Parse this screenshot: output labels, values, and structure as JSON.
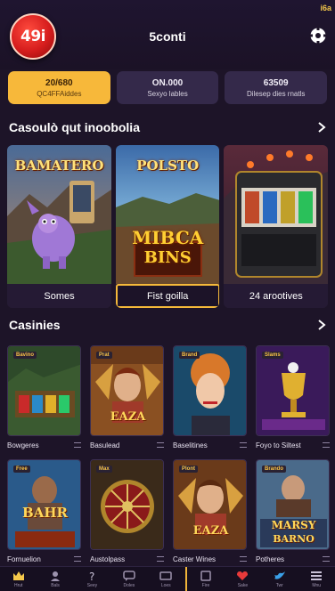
{
  "header": {
    "logo_text": "49i",
    "title": "5conti",
    "corner_text": "i6a"
  },
  "stats": [
    {
      "value": "20/680",
      "label": "QC4FFAiddes",
      "active": true
    },
    {
      "value": "ON.000",
      "label": "Sexyo lables",
      "active": false
    },
    {
      "value": "63509",
      "label": "Dilesep dies rnatls",
      "active": false
    }
  ],
  "featured": {
    "title": "Casoulò qut inoobolia",
    "cards": [
      {
        "art_title": "BAMATERO",
        "caption": "Somes"
      },
      {
        "art_title_top": "POLSTO",
        "art_title_bottom_1": "MIBCA",
        "art_title_bottom_2": "BINS",
        "caption": "Fist goilla"
      },
      {
        "art_title": "",
        "caption": "24 arootives"
      }
    ]
  },
  "casinos": {
    "title": "Casinies",
    "row1": [
      {
        "tag": "Bavino",
        "art": "",
        "name": "Bowgeres"
      },
      {
        "tag": "Prat",
        "art": "EAZA",
        "name": "Basulead"
      },
      {
        "tag": "Brand",
        "art": "",
        "name": "Baselitines"
      },
      {
        "tag": "Slams",
        "art": "",
        "name": "Foyo to Siltest"
      }
    ],
    "row2": [
      {
        "tag": "Free",
        "art": "BAHR",
        "name": "Fornuelion"
      },
      {
        "tag": "Max",
        "art": "",
        "name": "Austolpass"
      },
      {
        "tag": "Plont",
        "art": "EAZA",
        "name": "Caster Wines"
      },
      {
        "tag": "Brando",
        "art_1": "MARSY",
        "art_2": "BARNO",
        "name": "Potheres"
      }
    ]
  },
  "bottom_nav": [
    {
      "icon": "crown-icon",
      "label": "Hrut"
    },
    {
      "icon": "user-icon",
      "label": "Bals"
    },
    {
      "icon": "help-icon",
      "label": "Seey"
    },
    {
      "icon": "chat-icon",
      "label": "Doles"
    },
    {
      "icon": "video-icon",
      "label": "Loes"
    },
    {
      "icon": "card-icon",
      "label": "Fire"
    },
    {
      "icon": "heart-icon",
      "label": "Sake"
    },
    {
      "icon": "bird-icon",
      "label": "Twr"
    },
    {
      "icon": "menu-icon",
      "label": "Mnu"
    }
  ],
  "colors": {
    "background": "#1d1428",
    "accent": "#f7b83a",
    "logo_red": "#d61d1d"
  }
}
